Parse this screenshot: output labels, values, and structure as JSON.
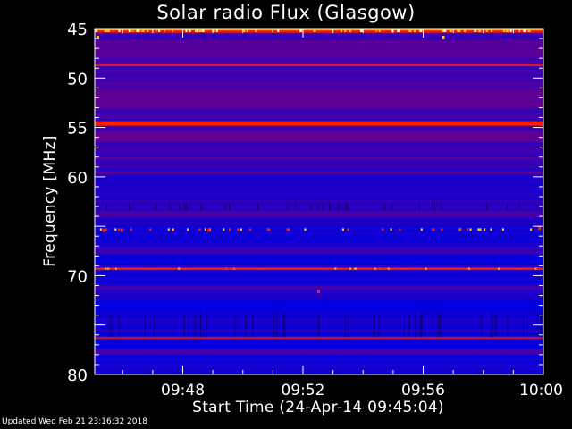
{
  "chart_data": {
    "type": "heatmap",
    "title": "Solar radio Flux (Glasgow)",
    "xlabel": "Start Time (24-Apr-14 09:45:04)",
    "ylabel": "Frequency [MHz]",
    "x_ticks": [
      "09:48",
      "09:52",
      "09:56",
      "10:00"
    ],
    "x_tick_minutes": [
      2.93,
      6.93,
      10.93,
      14.93
    ],
    "xlim_minutes": [
      0,
      14.93
    ],
    "y_ticks": [
      45,
      50,
      55,
      60,
      65,
      70,
      75,
      80
    ],
    "y_tick_labels": [
      "45",
      "50",
      "55",
      "60",
      "",
      "70",
      "",
      "80"
    ],
    "ylim": [
      45,
      80
    ],
    "y_inverted": true,
    "colors": {
      "low": "#0000e0",
      "mid": "#7a0080",
      "high": "#ff2000",
      "peak": "#ffd000",
      "axis": "#ffffff",
      "background": "#000000"
    },
    "bands": [
      {
        "freq": 45.1,
        "width": 0.25,
        "level": 1.0,
        "color": "peak"
      },
      {
        "freq": 45.3,
        "width": 0.25,
        "level": 0.9,
        "color": "high"
      },
      {
        "freq": 47.0,
        "width": 1.6,
        "level": 0.45,
        "color": "mid"
      },
      {
        "freq": 48.7,
        "width": 0.2,
        "level": 0.8,
        "color": "high"
      },
      {
        "freq": 52.0,
        "width": 2.0,
        "level": 0.5,
        "color": "mid"
      },
      {
        "freq": 54.6,
        "width": 0.45,
        "level": 1.0,
        "color": "high"
      },
      {
        "freq": 56.0,
        "width": 1.0,
        "level": 0.5,
        "color": "mid"
      },
      {
        "freq": 59.6,
        "width": 0.3,
        "level": 0.55,
        "color": "mid"
      },
      {
        "freq": 63.8,
        "width": 0.6,
        "level": 0.45,
        "color": "mid"
      },
      {
        "freq": 67.5,
        "width": 0.7,
        "level": 0.4,
        "color": "mid"
      },
      {
        "freq": 69.3,
        "width": 0.25,
        "level": 0.9,
        "color": "high"
      },
      {
        "freq": 71.2,
        "width": 0.3,
        "level": 0.45,
        "color": "mid"
      },
      {
        "freq": 76.3,
        "width": 0.25,
        "level": 0.6,
        "color": "high"
      },
      {
        "freq": 77.7,
        "width": 0.5,
        "level": 0.45,
        "color": "mid"
      }
    ],
    "bursts": [
      {
        "minute": 0.1,
        "freq": 45.9,
        "color": "peak"
      },
      {
        "minute": 11.6,
        "freq": 45.9,
        "color": "peak"
      },
      {
        "minute": 7.45,
        "freq": 71.6,
        "color": "high"
      },
      {
        "minute": 0.3,
        "freq": 65.4,
        "color": "high"
      },
      {
        "minute": 0.9,
        "freq": 65.4,
        "color": "high"
      },
      {
        "minute": 3.8,
        "freq": 65.4,
        "color": "high"
      },
      {
        "minute": 14.8,
        "freq": 65.2,
        "color": "high"
      }
    ]
  },
  "footer": {
    "updated": "Updated Wed Feb 21 23:16:32 2018"
  }
}
